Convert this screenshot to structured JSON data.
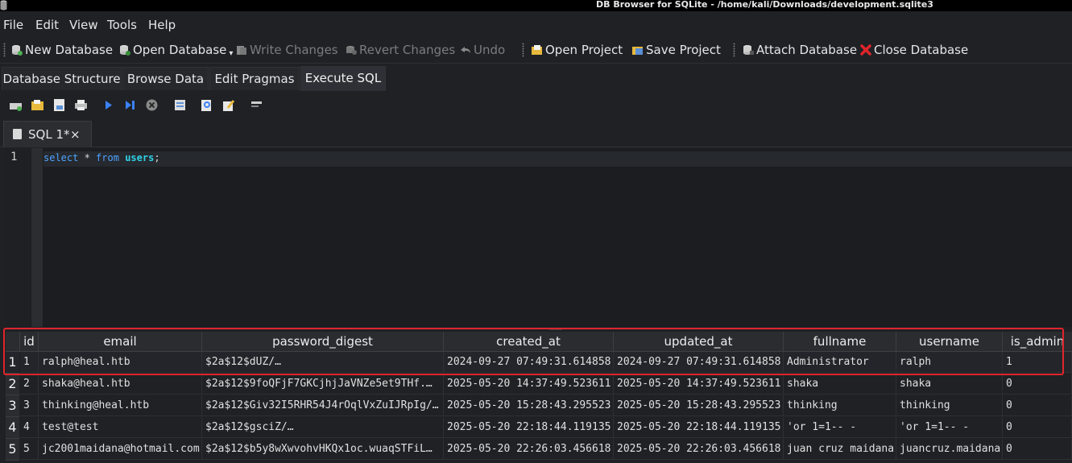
{
  "window": {
    "title": "DB Browser for SQLite - /home/kali/Downloads/development.sqlite3"
  },
  "menu": [
    "File",
    "Edit",
    "View",
    "Tools",
    "Help"
  ],
  "toolbar": {
    "new_database": "New Database",
    "open_database": "Open Database",
    "write_changes": "Write Changes",
    "revert_changes": "Revert Changes",
    "undo": "Undo",
    "open_project": "Open Project",
    "save_project": "Save Project",
    "attach_database": "Attach Database",
    "close_database": "Close Database"
  },
  "tabs": [
    "Database Structure",
    "Browse Data",
    "Edit Pragmas",
    "Execute SQL"
  ],
  "editor": {
    "tab_label": "SQL 1*",
    "close_glyph": "×",
    "line_number": "1",
    "query": {
      "kw1": "select",
      "mid": " * ",
      "kw2": "from",
      "space": " ",
      "table": "users",
      "end": ";"
    }
  },
  "results": {
    "columns": [
      "id",
      "email",
      "password_digest",
      "created_at",
      "updated_at",
      "fullname",
      "username",
      "is_admin"
    ],
    "rows": [
      [
        "1",
        "ralph@heal.htb",
        "$2a$12$dUZ/…",
        "2024-09-27 07:49:31.614858",
        "2024-09-27 07:49:31.614858",
        "Administrator",
        "ralph",
        "1"
      ],
      [
        "2",
        "shaka@heal.htb",
        "$2a$12$9foQFjF7GKCjhjJaVNZe5et9THf.…",
        "2025-05-20 14:37:49.523611",
        "2025-05-20 14:37:49.523611",
        "shaka",
        "shaka",
        "0"
      ],
      [
        "3",
        "thinking@heal.htb",
        "$2a$12$Giv32I5RHR54J4rOqlVxZuIJRpIg/…",
        "2025-05-20 15:28:43.295523",
        "2025-05-20 15:28:43.295523",
        "thinking",
        "thinking",
        "0"
      ],
      [
        "4",
        "test@test",
        "$2a$12$gsciZ/…",
        "2025-05-20 22:18:44.119135",
        "2025-05-20 22:18:44.119135",
        "'or 1=1-- -",
        "'or 1=1-- -",
        "0"
      ],
      [
        "5",
        "jc2001maidana@hotmail.com",
        "$2a$12$b5y8wXwvohvHKQx1oc.wuaqSTFiL…",
        "2025-05-20 22:26:03.456618",
        "2025-05-20 22:26:03.456618",
        "juan cruz maidana",
        "juancruz.maidana",
        "0"
      ]
    ],
    "row_numbers": [
      "1",
      "2",
      "3",
      "4",
      "5"
    ]
  },
  "colors": {
    "highlight": "#e0252b",
    "keyword": "#4ea3ff",
    "table_name": "#2fd3e6",
    "close_icon": "#e0252b"
  }
}
